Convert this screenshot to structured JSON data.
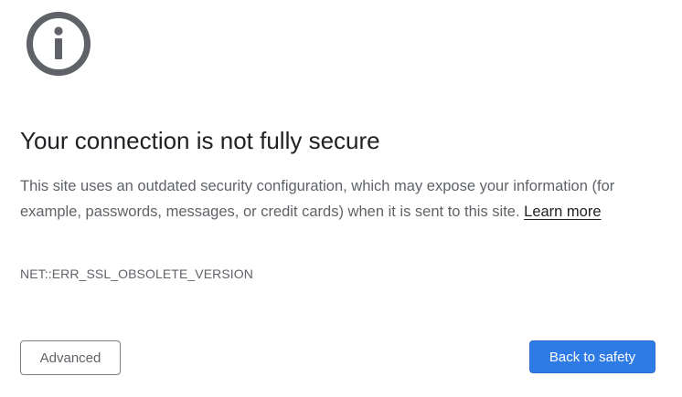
{
  "icon": "info-circle-icon",
  "heading": "Your connection is not fully secure",
  "description": {
    "text": "This site uses an outdated security configuration, which may expose your information (for example, passwords, messages, or credit cards) when it is sent to this site. ",
    "link_label": "Learn more"
  },
  "error_code": "NET::ERR_SSL_OBSOLETE_VERSION",
  "buttons": {
    "advanced_label": "Advanced",
    "back_label": "Back to safety"
  },
  "colors": {
    "primary_button": "#2f7be5",
    "icon": "#5f6368",
    "heading": "#202124",
    "body_text": "#5f6368"
  }
}
